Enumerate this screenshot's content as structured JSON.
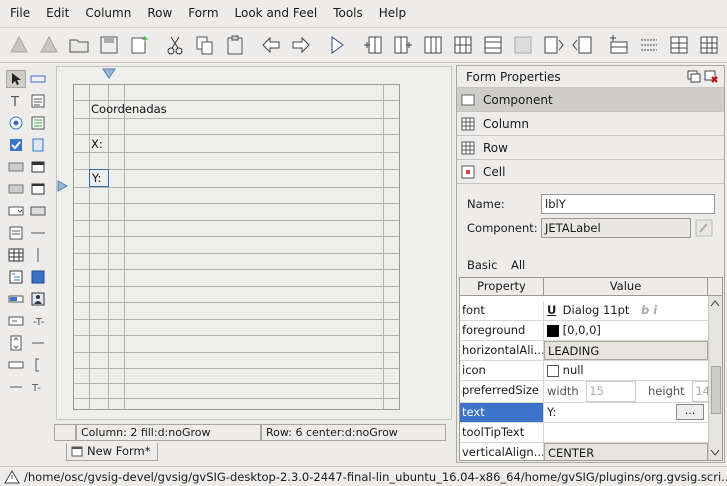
{
  "menu": [
    "File",
    "Edit",
    "Column",
    "Row",
    "Form",
    "Look and Feel",
    "Tools",
    "Help"
  ],
  "grid_cells": {
    "title": "Coordenadas",
    "x_label": "X:",
    "y_label": "Y:"
  },
  "status": {
    "column": "Column:  2  fill:d:noGrow",
    "row": "Row:  6  center:d:noGrow"
  },
  "form_tab": "New Form*",
  "props": {
    "title": "Form Properties",
    "sections": [
      "Component",
      "Column",
      "Row",
      "Cell"
    ],
    "name_label": "Name:",
    "name_value": "lblY",
    "component_label": "Component:",
    "component_value": "JETALabel",
    "tabs": [
      "Basic",
      "All"
    ],
    "table_head": [
      "Property",
      "Value"
    ],
    "rows": [
      {
        "name": "font",
        "value": "Dialog 11pt"
      },
      {
        "name": "foreground",
        "value": "[0,0,0]"
      },
      {
        "name": "horizontalAli...",
        "value": "LEADING"
      },
      {
        "name": "icon",
        "value": "null"
      },
      {
        "name": "preferredSize",
        "value": "width",
        "value2": "15",
        "value3": "height",
        "value4": "14"
      },
      {
        "name": "text",
        "value": "Y:"
      },
      {
        "name": "toolTipText",
        "value": ""
      },
      {
        "name": "verticalAlign...",
        "value": "CENTER"
      }
    ],
    "ellipsis": "..."
  },
  "path": "/home/osc/gvsig-devel/gvsig/gvSIG-desktop-2.3.0-2447-final-lin_ubuntu_16.04-x86_64/home/gvSIG/plugins/org.gvsig.scri...",
  "colors": {
    "selection": "#3a73c8",
    "accent": "#2f6db5"
  }
}
